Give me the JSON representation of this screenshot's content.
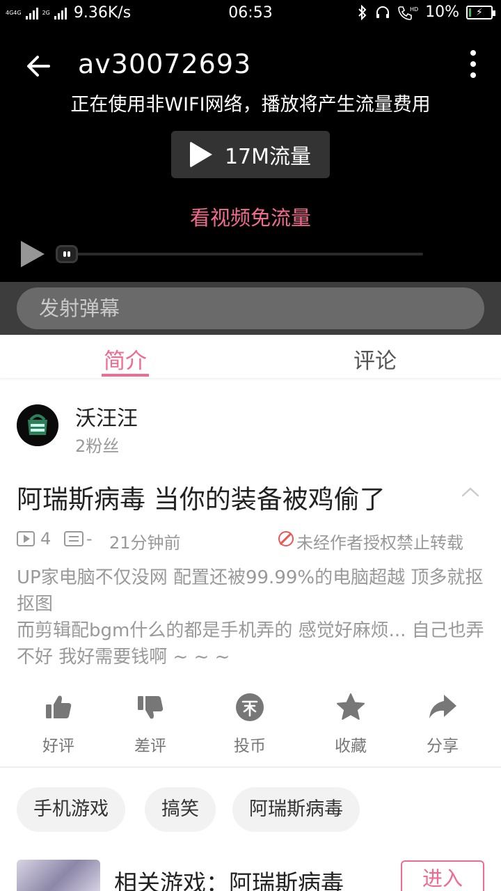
{
  "status_bar": {
    "network_1": "4G",
    "network_2": "4G",
    "network_3": "2G",
    "speed": "9.36K/s",
    "time": "06:53",
    "battery": "10%",
    "battery_level": 0.1
  },
  "player": {
    "video_id": "av30072693",
    "network_warning": "正在使用非WIFI网络，播放将产生流量费用",
    "play_button_label": "17M流量",
    "free_data_link": "看视频免流量"
  },
  "danmaku": {
    "placeholder": "发射弹幕"
  },
  "tabs": {
    "intro": "简介",
    "comments": "评论"
  },
  "uploader": {
    "name": "沃汪汪",
    "fans": "2粉丝"
  },
  "video": {
    "title": "阿瑞斯病毒 当你的装备被鸡偷了",
    "views": "4",
    "danmaku_count": "-",
    "time_ago": "21分钟前",
    "copyright": "未经作者授权禁止转载",
    "description_1": "UP家电脑不仅没网 配置还被99.99%的电脑超越 顶多就抠抠图",
    "description_2": "而剪辑配bgm什么的都是手机弄的 感觉好麻烦... 自己也弄不好  我好需要钱啊 ~ ~ ~"
  },
  "actions": {
    "like": "好评",
    "dislike": "差评",
    "coin": "投币",
    "favorite": "收藏",
    "share": "分享"
  },
  "tags": [
    "手机游戏",
    "搞笑",
    "阿瑞斯病毒"
  ],
  "related_game": {
    "label": "相关游戏：阿瑞斯病毒",
    "enter": "进入"
  },
  "colors": {
    "accent": "#f26b8e",
    "warning": "#e55555"
  }
}
